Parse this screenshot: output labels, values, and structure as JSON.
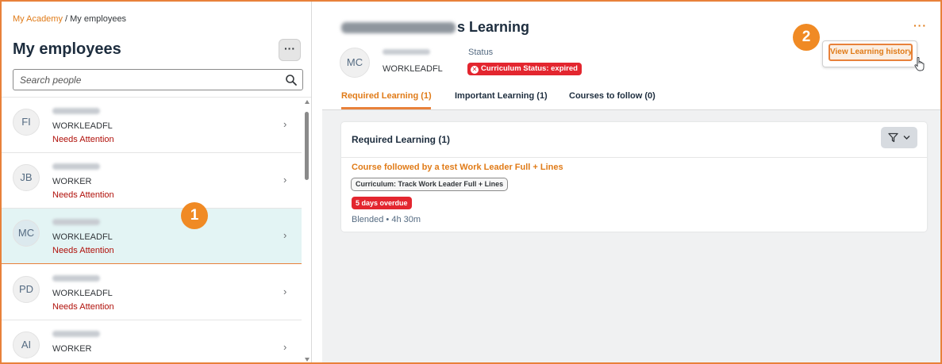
{
  "breadcrumb": {
    "link": "My Academy",
    "separator": " / ",
    "current": "My employees"
  },
  "sidebar": {
    "title": "My employees",
    "more_label": "···",
    "search": {
      "placeholder": "Search people",
      "icon": "search-icon"
    },
    "employees": [
      {
        "initials": "FI",
        "role": "WORKLEADFL",
        "status": "Needs Attention",
        "selected": false
      },
      {
        "initials": "JB",
        "role": "WORKER",
        "status": "Needs Attention",
        "selected": false
      },
      {
        "initials": "MC",
        "role": "WORKLEADFL",
        "status": "Needs Attention",
        "selected": true
      },
      {
        "initials": "PD",
        "role": "WORKLEADFL",
        "status": "Needs Attention",
        "selected": false
      },
      {
        "initials": "AI",
        "role": "WORKER",
        "status": "",
        "selected": false
      }
    ],
    "chevron": "›"
  },
  "detail": {
    "title_suffix": "s Learning",
    "more_label": "···",
    "avatar_initials": "MC",
    "role": "WORKLEADFL",
    "status_label": "Status",
    "status_badge": "Curriculum Status: expired",
    "view_history_label": "View Learning history",
    "tabs": [
      {
        "label": "Required Learning (1)",
        "active": true
      },
      {
        "label": "Important Learning (1)",
        "active": false
      },
      {
        "label": "Courses to follow (0)",
        "active": false
      }
    ],
    "card": {
      "title": "Required Learning (1)",
      "course_title": "Course followed by a test Work Leader Full + Lines",
      "curriculum_tag": "Curriculum: Track Work Leader Full + Lines",
      "overdue_badge": "5 days overdue",
      "meta": "Blended • 4h 30m"
    }
  },
  "callouts": [
    "1",
    "2"
  ],
  "colors": {
    "accent": "#e07b18",
    "callout": "#f08a24",
    "danger": "#e3262f",
    "selected_row": "#e3f4f4",
    "attention": "#b0100a"
  }
}
